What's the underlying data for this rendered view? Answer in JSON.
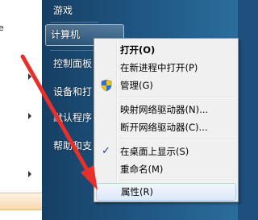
{
  "left_pane": {
    "cut_text": "e"
  },
  "right_pane": {
    "items": [
      {
        "label": "游戏"
      },
      {
        "label": "计算机"
      },
      {
        "label": "控制面板"
      },
      {
        "label": "设备和打"
      },
      {
        "label": "默认程序"
      },
      {
        "label": "帮助和支"
      }
    ]
  },
  "context_menu": {
    "items": [
      {
        "label": "打开(O)"
      },
      {
        "label": "在新进程中打开(P)"
      },
      {
        "label": "管理(G)"
      },
      {
        "label": "映射网络驱动器(N)..."
      },
      {
        "label": "断开网络驱动器(C)..."
      },
      {
        "label": "在桌面上显示(S)"
      },
      {
        "label": "重命名(M)"
      },
      {
        "label": "属性(R)"
      }
    ],
    "check_glyph": "✓"
  },
  "colors": {
    "annotation_arrow": "#e8302a",
    "hover_highlight": "#dce9f8"
  }
}
